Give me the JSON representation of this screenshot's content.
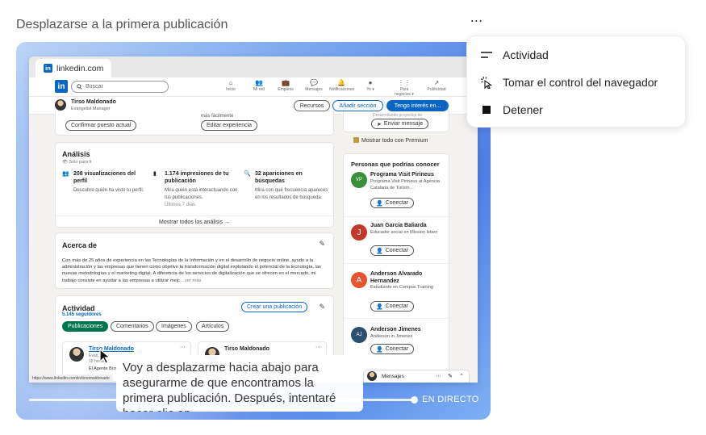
{
  "task": {
    "title": "Desplazarse a la primera publicación",
    "more_icon": "⋯"
  },
  "menu": {
    "items": [
      {
        "label": "Actividad",
        "icon": "activity-lines-icon"
      },
      {
        "label": "Tomar el control del navegador",
        "icon": "cursor-click-icon"
      },
      {
        "label": "Detener",
        "icon": "stop-square-icon"
      }
    ]
  },
  "stream": {
    "live_label": "EN DIRECTO",
    "progress": 1.0
  },
  "caption": {
    "text": "Voy a desplazarme hacia abajo para asegurarme de que encontramos la primera publicación. Después, intentaré hacer clic en"
  },
  "browser": {
    "tab_title": "linkedin.com",
    "status_url": "https://www.linkedin.com/in/tirsomaldonado",
    "nav": {
      "logo": "in",
      "search_placeholder": "Buscar",
      "items": [
        {
          "label": "Inicio",
          "icon": "⌂"
        },
        {
          "label": "Mi red",
          "icon": "👥"
        },
        {
          "label": "Empleos",
          "icon": "💼"
        },
        {
          "label": "Mensajes",
          "icon": "💬"
        },
        {
          "label": "Notificaciones",
          "icon": "🔔"
        },
        {
          "label": "Yo ▾",
          "icon": "●"
        },
        {
          "label": "Para negocios ▾",
          "icon": "⋮⋮"
        },
        {
          "label": "Publicidad",
          "icon": "↗"
        }
      ]
    },
    "profile_bar": {
      "name": "Tirso Maldonado",
      "subtitle": "Evangelist Manager",
      "btn_recursos": "Recursos",
      "btn_anadir": "Añadir sección",
      "btn_interes": "Tengo interés en..."
    },
    "top_cards": {
      "confirm_btn": "Confirmar puesto actual",
      "edit_btn": "Editar experiencia",
      "small_text": "más fácilmente",
      "send_msg_btn": "Enviar mensaje",
      "premium_link": "Mostrar todo con Premium",
      "right_top_text": "Desarrollando proyectos de"
    },
    "analisis": {
      "title": "Análisis",
      "private": "Solo para ti",
      "stats": [
        {
          "title": "208 visualizaciones del perfil",
          "desc": "Descubre quién ha visto tu perfil."
        },
        {
          "title": "1.174 impresiones de tu publicación",
          "desc": "Mira quién está interactuando con tus publicaciones.",
          "extra": "Últimos 7 días"
        },
        {
          "title": "32 apariciones en búsquedas",
          "desc": "Mira con qué frecuencia apareces en los resultados de búsqueda."
        }
      ],
      "show_all": "Mostrar todos los análisis →"
    },
    "acerca": {
      "title": "Acerca de",
      "text": "Con más de 25 años de experiencia en las Tecnologías de la Información y en el desarrollo de negocio online, ayudo a la administración y las empresas que tienen como objetivo la transformación digital explotando el potencial de la tecnología, las nuevas metodologías y el marketing digital. A diferencia de los servicios de digitalización que se ofrecen en el mercado, mi trabajo consiste en ayudar a las empresas a utilizar mejc",
      "more": "…ver más"
    },
    "actividad": {
      "title": "Actividad",
      "followers": "5.145 seguidores",
      "create_btn": "Crear una publicación",
      "tabs": [
        "Publicaciones",
        "Comentarios",
        "Imágenes",
        "Artículos"
      ],
      "post1_name": "Tirso Maldonado",
      "post1_sub": "Evan...",
      "post1_time": "18 horas",
      "post1_extra": "El Agente Browser…",
      "post2_name": "Tirso Maldonado"
    },
    "people": {
      "title": "Personas que podrías conocer",
      "connect": "Conectar",
      "list": [
        {
          "name": "Programa Visit Pirineus",
          "desc": "Programa Visit Pirineus at Agència Catalana de Turism…",
          "initial": "VP",
          "color": "#3a8f3a"
        },
        {
          "name": "Juan García Baliarda",
          "desc": "Educador social en Mission leben",
          "initial": "J",
          "color": "#c0392b"
        },
        {
          "name": "Anderson Alvarado Hernandez",
          "desc": "Estudiante en Campus Training",
          "initial": "A",
          "color": "#e8542f"
        },
        {
          "name": "Anderson Jimenes",
          "desc": "Anderson in Jimenez",
          "initial": "AJ",
          "color": "#2b4f6e"
        }
      ]
    },
    "messages_label": "Mensajes"
  }
}
